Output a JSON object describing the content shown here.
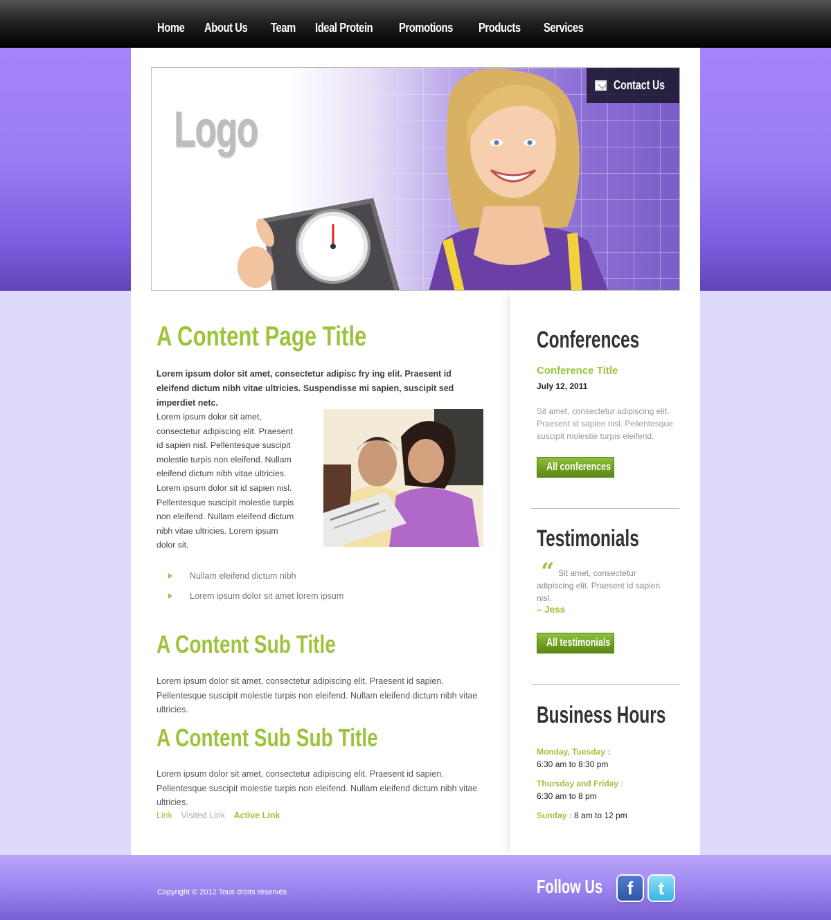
{
  "nav": {
    "items": [
      "Home",
      "About Us",
      "Team",
      "Ideal Protein",
      "Promotions",
      "Products",
      "Services"
    ]
  },
  "header": {
    "logo_text": "Logo",
    "contact_label": "Contact Us"
  },
  "main": {
    "title": "A Content Page Title",
    "intro": "Lorem ipsum dolor sit amet, consectetur adipisc fry ing elit. Praesent id eleifend dictum nibh vitae ultricies. Suspendisse mi sapien, suscipit sed imperdiet netc.",
    "paragraph1": "Lorem ipsum dolor sit amet, consectetur adipiscing elit. Praesent id sapien nisl. Pellentesque suscipit molestie turpis non eleifend. Nullam eleifend dictum nibh vitae ultricies. Lorem ipsum dolor sit id sapien nisl. Pellentesque suscipit molestie turpis non eleifend. Nullam eleifend dictum nibh vitae ultricies. Lorem ipsum dolor sit.",
    "bullets": [
      "Nullam eleifend dictum nibh",
      "Lorem ipsum dolor sit amet lorem ipsum"
    ],
    "subtitle": "A Content Sub Title",
    "paragraph2": "Lorem ipsum dolor sit amet, consectetur adipiscing elit. Praesent id sapien. Pellentesque suscipit molestie turpis non eleifend. Nullam eleifend dictum nibh vitae ultricies.",
    "subsubtitle": "A Content Sub Sub Title",
    "paragraph3": "Lorem ipsum dolor sit amet, consectetur adipiscing elit. Praesent id sapien. Pellentesque suscipit molestie turpis non eleifend. Nullam eleifend dictum nibh vitae ultricies.",
    "links": {
      "link": "Link",
      "visited": "Visited Link",
      "active": "Active Link"
    }
  },
  "sidebar": {
    "conferences": {
      "heading": "Conferences",
      "title": "Conference Title",
      "date": "July 12, 2011",
      "text": "Sit amet, consectetur adipiscing elit. Praesent id sapien nisl. Pellentesque suscipit molestie turpis eleifend.",
      "button": "All conferences"
    },
    "testimonials": {
      "heading": "Testimonials",
      "quote_mark": "“",
      "text": "Sit amet, consectetur adipiscing elit. Praesent id sapien nisl.",
      "author": "– Jess",
      "button": "All testimonials"
    },
    "hours": {
      "heading": "Business Hours",
      "mon_tue_label": "Monday, Tuesday :",
      "mon_tue_time": "6:30 am to 8:30 pm",
      "thu_fri_label": "Thursday and Friday :",
      "thu_fri_time": "6:30 am to 8 pm",
      "sun_label": "Sunday :",
      "sun_time": " 8 am to 12 pm"
    }
  },
  "footer": {
    "copyright": "Copyright © 2012 Tous droits réservés",
    "follow_label": "Follow Us",
    "facebook_glyph": "f",
    "twitter_glyph": "t"
  },
  "colors": {
    "accent_green": "#9dc33b",
    "purple": "#9a7ef5",
    "lavender": "#ddd9fb"
  },
  "icons": [
    "envelope-icon",
    "facebook-icon",
    "twitter-icon",
    "bullet-arrow-icon"
  ]
}
